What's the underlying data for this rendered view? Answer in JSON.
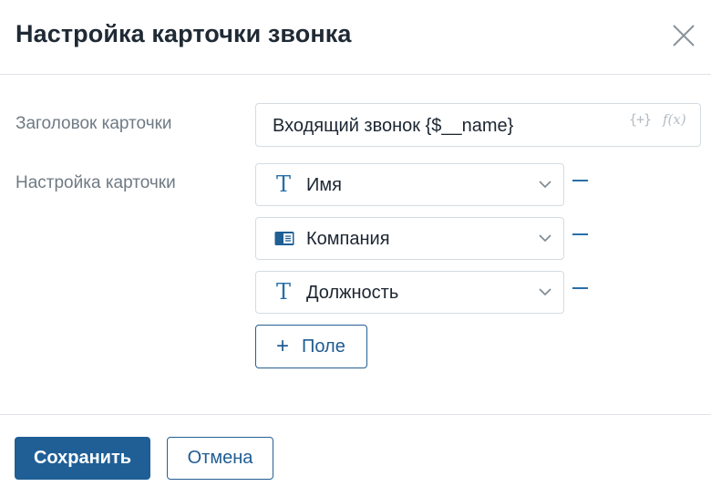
{
  "dialog": {
    "title": "Настройка карточки звонка",
    "close_icon": "close-icon"
  },
  "form": {
    "card_title_label": "Заголовок карточки",
    "card_title_value": "Входящий звонок {$__name}",
    "variable_icon_text": "{+}",
    "formula_icon_text": "f(x)",
    "card_settings_label": "Настройка карточки",
    "fields": [
      {
        "label": "Имя",
        "type_icon": "text-type-icon",
        "type_glyph": "T"
      },
      {
        "label": "Компания",
        "type_icon": "app-type-icon",
        "type_glyph": ""
      },
      {
        "label": "Должность",
        "type_icon": "text-type-icon",
        "type_glyph": "T"
      }
    ],
    "add_field_plus": "+",
    "add_field_label": "Поле"
  },
  "footer": {
    "save_label": "Сохранить",
    "cancel_label": "Отмена"
  },
  "colors": {
    "accent": "#1f5f96",
    "border": "#d5dbe0",
    "label": "#6f7a84"
  }
}
